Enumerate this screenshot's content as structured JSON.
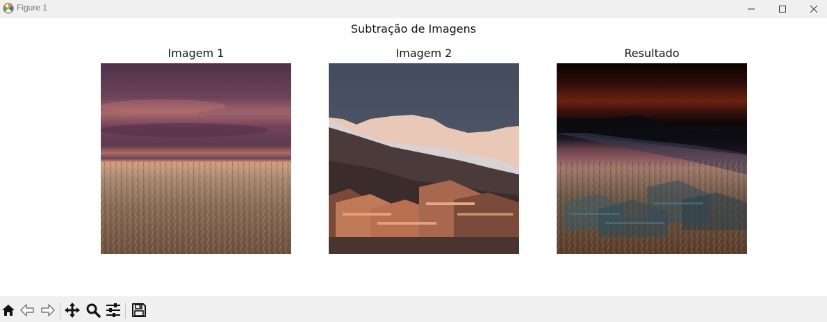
{
  "window": {
    "title": "Figure 1",
    "controls": {
      "minimize": "minimize-icon",
      "maximize": "maximize-icon",
      "close": "close-icon"
    }
  },
  "figure": {
    "suptitle": "Subtração de Imagens",
    "axes": [
      {
        "title": "Imagem 1",
        "image": "wheat field under a purple and orange sunset sky"
      },
      {
        "title": "Imagem 2",
        "image": "snowy mountain range above a village of chalet rooftops at dusk"
      },
      {
        "title": "Resultado",
        "image": "difference image: dark red sky with teal-tinted ghosted houses over wheat field"
      }
    ]
  },
  "toolbar": {
    "buttons": [
      {
        "name": "home-icon",
        "label": "Home"
      },
      {
        "name": "back-arrow-icon",
        "label": "Back"
      },
      {
        "name": "forward-arrow-icon",
        "label": "Forward"
      },
      {
        "name": "pan-icon",
        "label": "Pan"
      },
      {
        "name": "zoom-icon",
        "label": "Zoom"
      },
      {
        "name": "configure-subplots-icon",
        "label": "Configure subplots"
      },
      {
        "name": "save-icon",
        "label": "Save"
      }
    ]
  },
  "colors": {
    "titlebar_bg": "#f0f0f0",
    "toolbar_bg": "#f0f0f0",
    "canvas_bg": "#ffffff",
    "text": "#111111"
  }
}
